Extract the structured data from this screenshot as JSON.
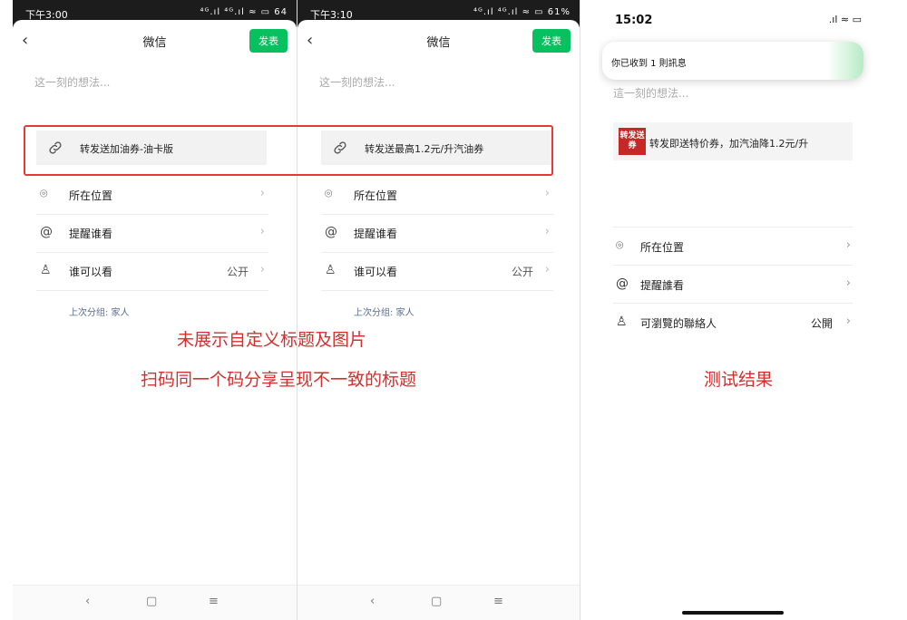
{
  "colors": {
    "accent": "#07c160",
    "annotation": "#d32f2f",
    "group_link": "#576b95"
  },
  "screen1": {
    "status_time": "下午3:00",
    "status_right": "⁴ᴳ.ıl ⁴ᴳ.ıl ≈ ▭ 64",
    "title": "微信",
    "publish_label": "发表",
    "placeholder": "这一刻的想法...",
    "link_title": "转发送加油券-油卡版",
    "rows": [
      {
        "icon": "location-icon",
        "label": "所在位置",
        "value": ""
      },
      {
        "icon": "at-icon",
        "label": "提醒谁看",
        "value": ""
      },
      {
        "icon": "person-icon",
        "label": "谁可以看",
        "value": "公开"
      }
    ],
    "group_note": "上次分组: 家人"
  },
  "screen2": {
    "status_time": "下午3:10",
    "status_right": "⁴ᴳ.ıl ⁴ᴳ.ıl ≈ ▭ 61%",
    "title": "微信",
    "publish_label": "发表",
    "placeholder": "这一刻的想法...",
    "link_title": "转发送最高1.2元/升汽油券",
    "rows": [
      {
        "icon": "location-icon",
        "label": "所在位置",
        "value": ""
      },
      {
        "icon": "at-icon",
        "label": "提醒谁看",
        "value": ""
      },
      {
        "icon": "person-icon",
        "label": "谁可以看",
        "value": "公开"
      }
    ],
    "group_note": "上次分组: 家人"
  },
  "screen3": {
    "status_time": "15:02",
    "status_right": ".ıl ≈ ▭",
    "notification": "你已收到 1 則訊息",
    "placeholder": "這一刻的想法...",
    "thumb_text": "转发送券",
    "link_title": "转发即送特价券，加汽油降1.2元/升",
    "rows": [
      {
        "icon": "location-icon",
        "label": "所在位置",
        "value": ""
      },
      {
        "icon": "at-icon",
        "label": "提醒誰看",
        "value": ""
      },
      {
        "icon": "person-icon",
        "label": "可瀏覽的聯絡人",
        "value": "公開"
      }
    ],
    "caption": "测试结果"
  },
  "annotations": {
    "line1": "未展示自定义标题及图片",
    "line2": "扫码同一个码分享呈现不一致的标题"
  }
}
